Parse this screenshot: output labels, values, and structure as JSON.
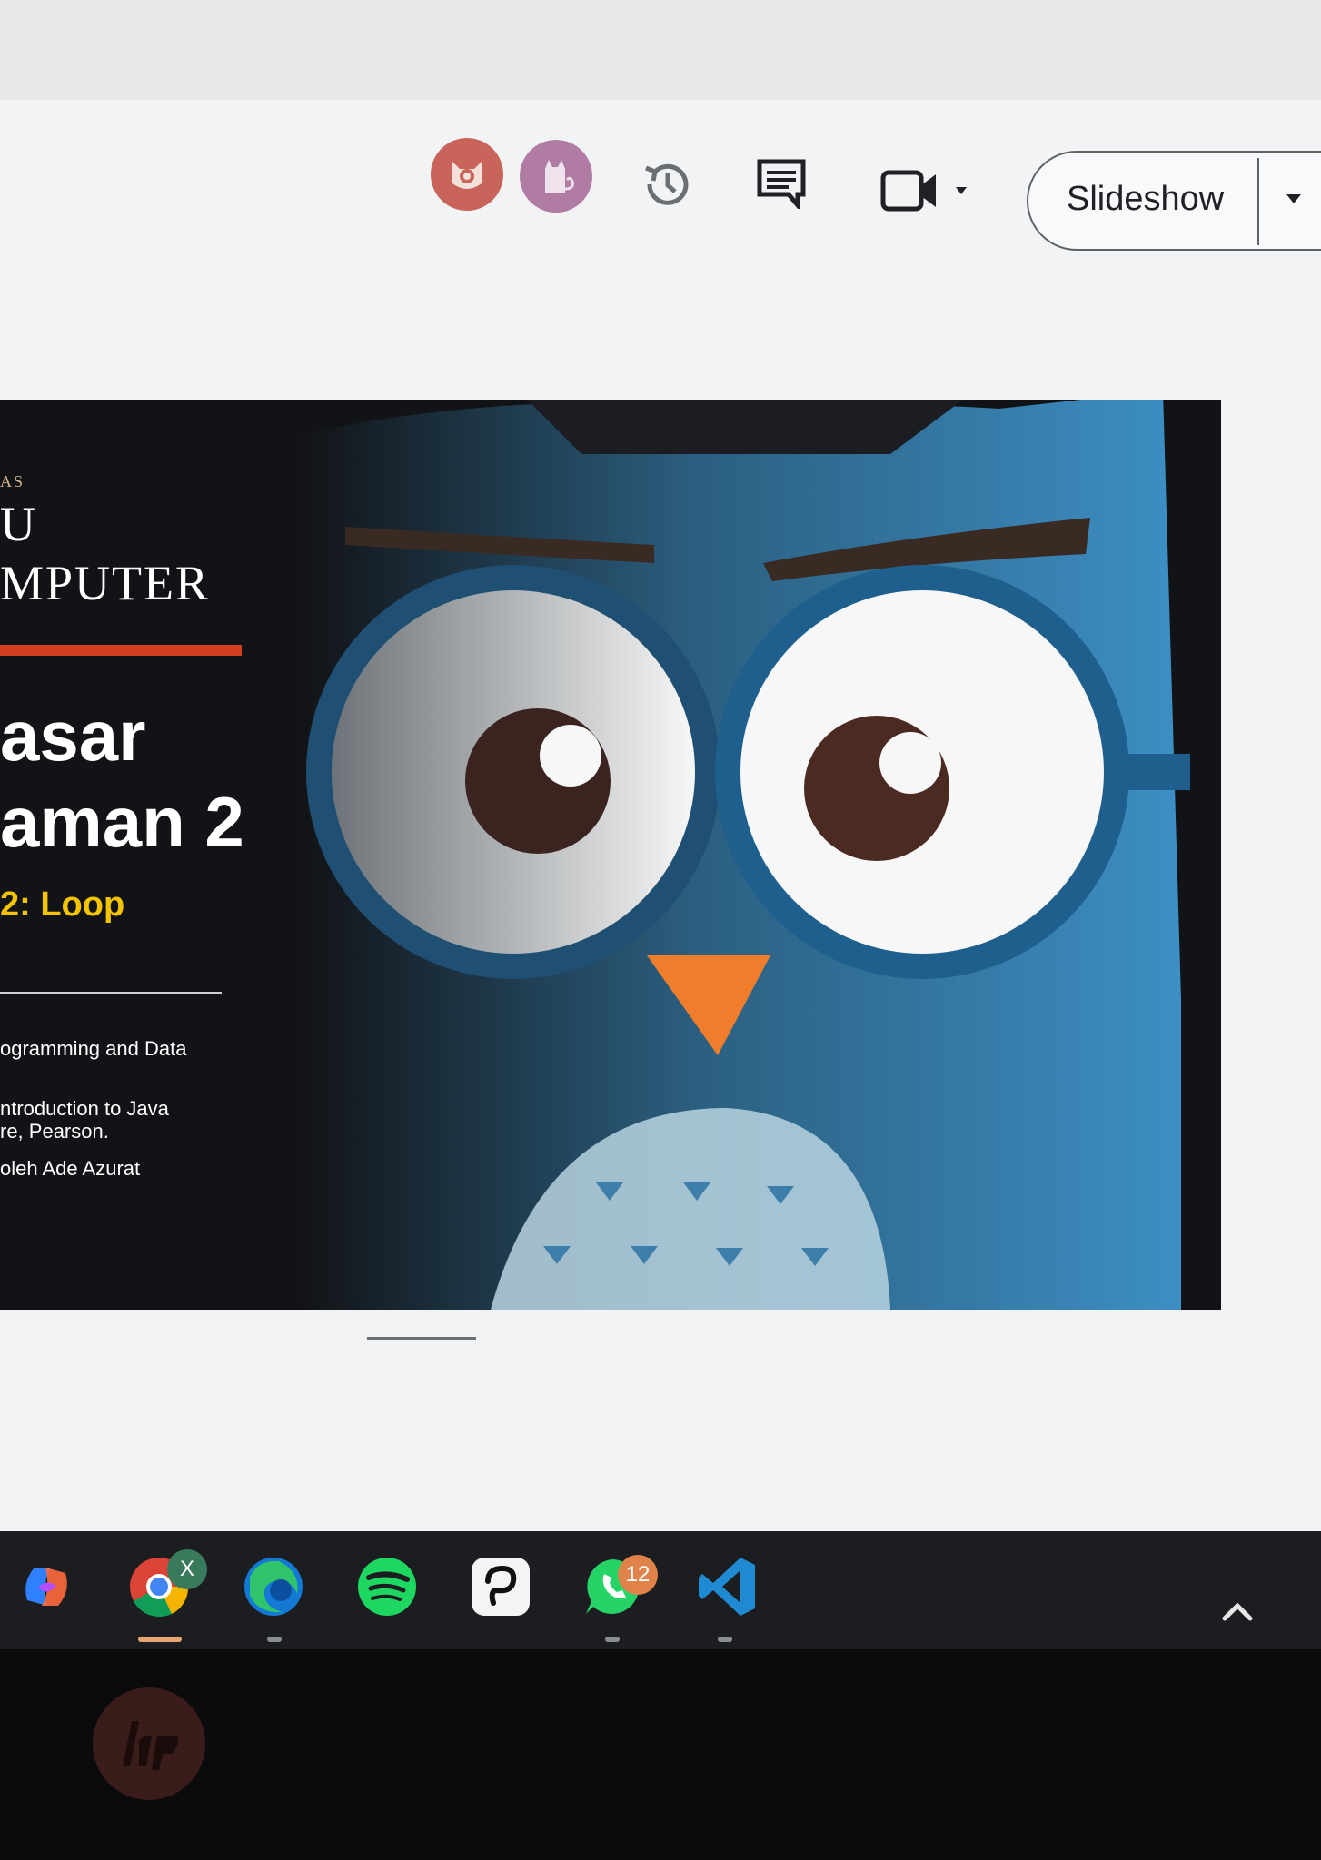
{
  "toolbar": {
    "slideshow_label": "Slideshow"
  },
  "slide": {
    "small_caps": "AS",
    "brand_line1": "U",
    "brand_line2": "MPUTER",
    "course_line1": "asar",
    "course_line2": "aman 2",
    "chapter": "2: Loop",
    "ref_line1": "ogramming and Data",
    "ref_line2a": "ntroduction to Java",
    "ref_line2b": "re, Pearson.",
    "ref_line3": "oleh Ade Azurat"
  },
  "taskbar": {
    "apps": [
      "copilot-icon",
      "chrome-icon",
      "edge-icon",
      "spotify-icon",
      "lasso-icon",
      "whatsapp-icon",
      "vscode-icon"
    ],
    "whatsapp_badge": "12",
    "chrome_badge": "X"
  },
  "colors": {
    "accent_red": "#d4401f",
    "chapter_yellow": "#f2c400",
    "owl_blue": "#3d8fc4"
  }
}
